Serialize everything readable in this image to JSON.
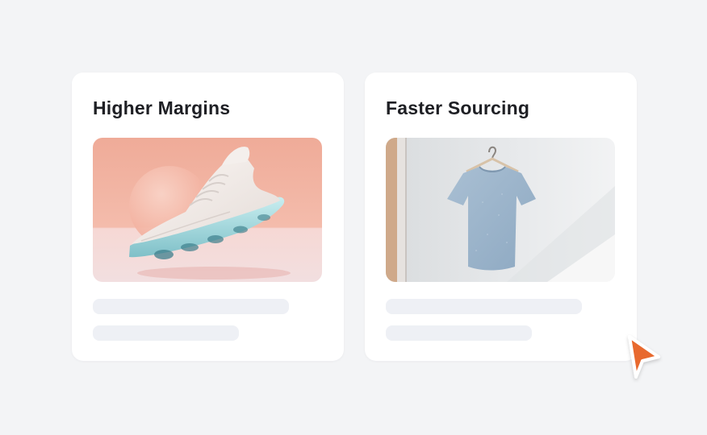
{
  "cards": [
    {
      "title": "Higher Margins",
      "image": {
        "icon": "sneaker-photo",
        "background": "#f2b3a2"
      }
    },
    {
      "title": "Faster Sourcing",
      "image": {
        "icon": "tshirt-photo",
        "background": "#e6e8ea"
      }
    }
  ],
  "colors": {
    "page_background": "#f3f4f6",
    "card_background": "#ffffff",
    "skeleton": "#eef0f5",
    "cursor": "#e8692e"
  },
  "cursor": {
    "icon": "cursor-arrow-icon"
  }
}
